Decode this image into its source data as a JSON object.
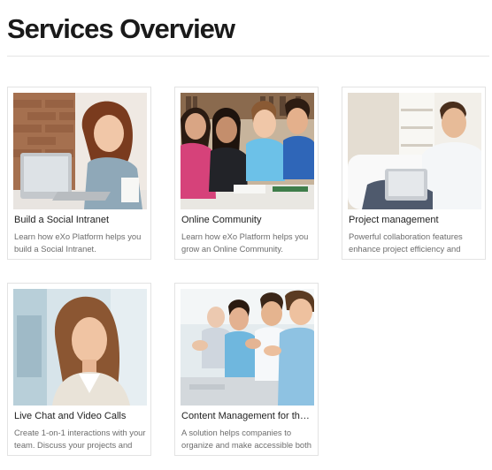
{
  "page": {
    "title": "Services Overview"
  },
  "cards": [
    {
      "title": "Build a Social Intranet",
      "description": "Learn how eXo Platform helps you build a Social Intranet."
    },
    {
      "title": "Online Community",
      "description": "Learn how eXo Platform helps you grow an Online Community."
    },
    {
      "title": "Project management",
      "description": "Powerful collaboration features enhance project efficiency and"
    },
    {
      "title": "Live Chat and Video Calls",
      "description": "Create 1-on-1 interactions with your team. Discuss your projects and"
    },
    {
      "title": "Content Management for the ...",
      "description": "A solution helps companies to organize and make accessible both"
    }
  ]
}
